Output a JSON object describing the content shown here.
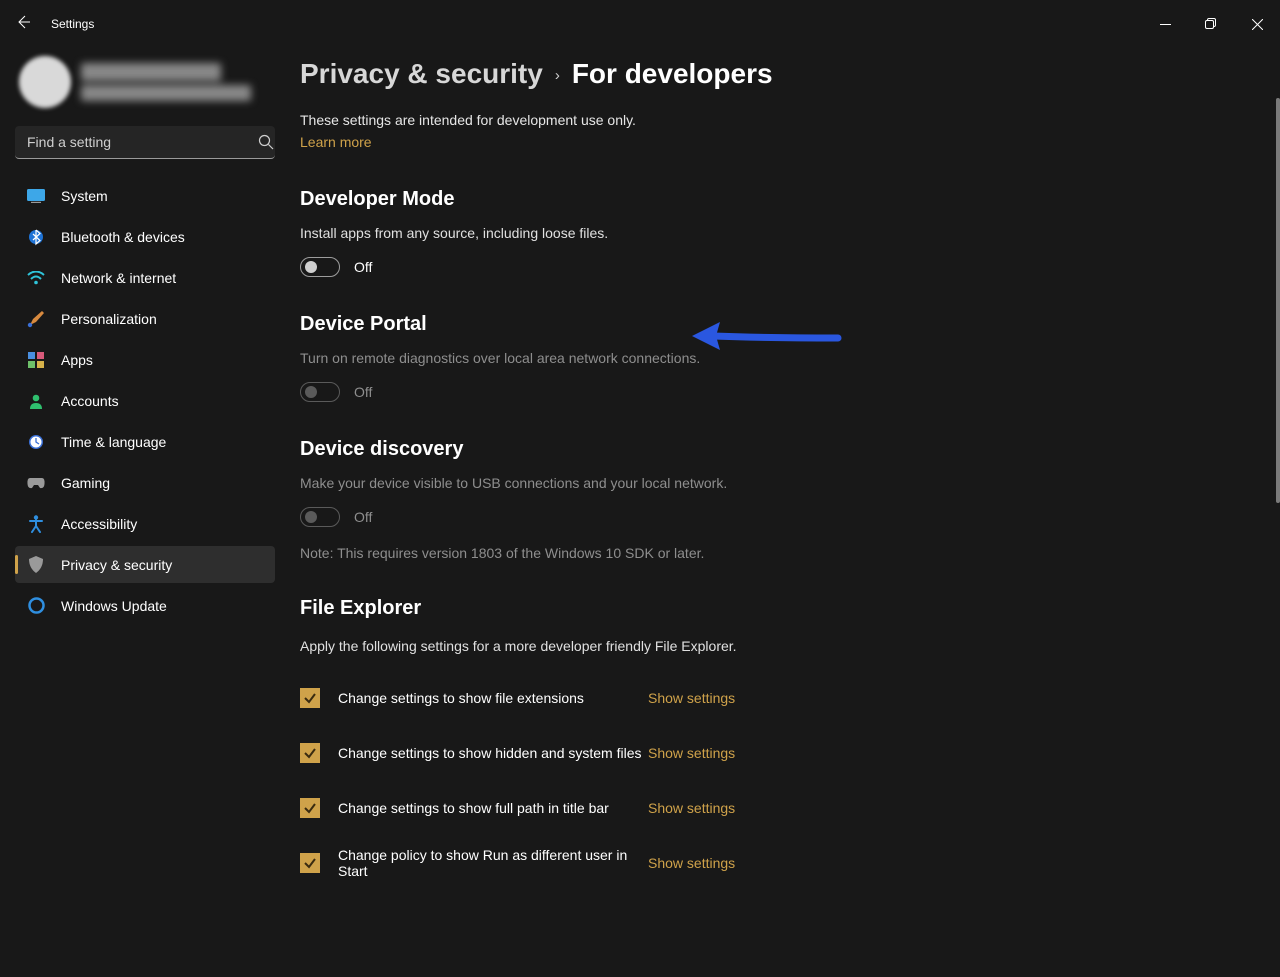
{
  "window": {
    "title": "Settings"
  },
  "search": {
    "placeholder": "Find a setting"
  },
  "nav": {
    "system": "System",
    "bluetooth": "Bluetooth & devices",
    "network": "Network & internet",
    "personalization": "Personalization",
    "apps": "Apps",
    "accounts": "Accounts",
    "time": "Time & language",
    "gaming": "Gaming",
    "accessibility": "Accessibility",
    "privacy": "Privacy & security",
    "update": "Windows Update"
  },
  "breadcrumb": {
    "parent": "Privacy & security",
    "current": "For developers"
  },
  "intro": {
    "text": "These settings are intended for development use only.",
    "learn": "Learn more"
  },
  "devmode": {
    "title": "Developer Mode",
    "desc": "Install apps from any source, including loose files.",
    "state": "Off"
  },
  "portal": {
    "title": "Device Portal",
    "desc": "Turn on remote diagnostics over local area network connections.",
    "state": "Off"
  },
  "discovery": {
    "title": "Device discovery",
    "desc": "Make your device visible to USB connections and your local network.",
    "state": "Off",
    "note": "Note: This requires version 1803 of the Windows 10 SDK or later."
  },
  "explorer": {
    "title": "File Explorer",
    "desc": "Apply the following settings for a more developer friendly File Explorer.",
    "link": "Show settings",
    "items": [
      "Change settings to show file extensions",
      "Change settings to show hidden and system files",
      "Change settings to show full path in title bar",
      "Change policy to show Run as different user in Start"
    ]
  }
}
